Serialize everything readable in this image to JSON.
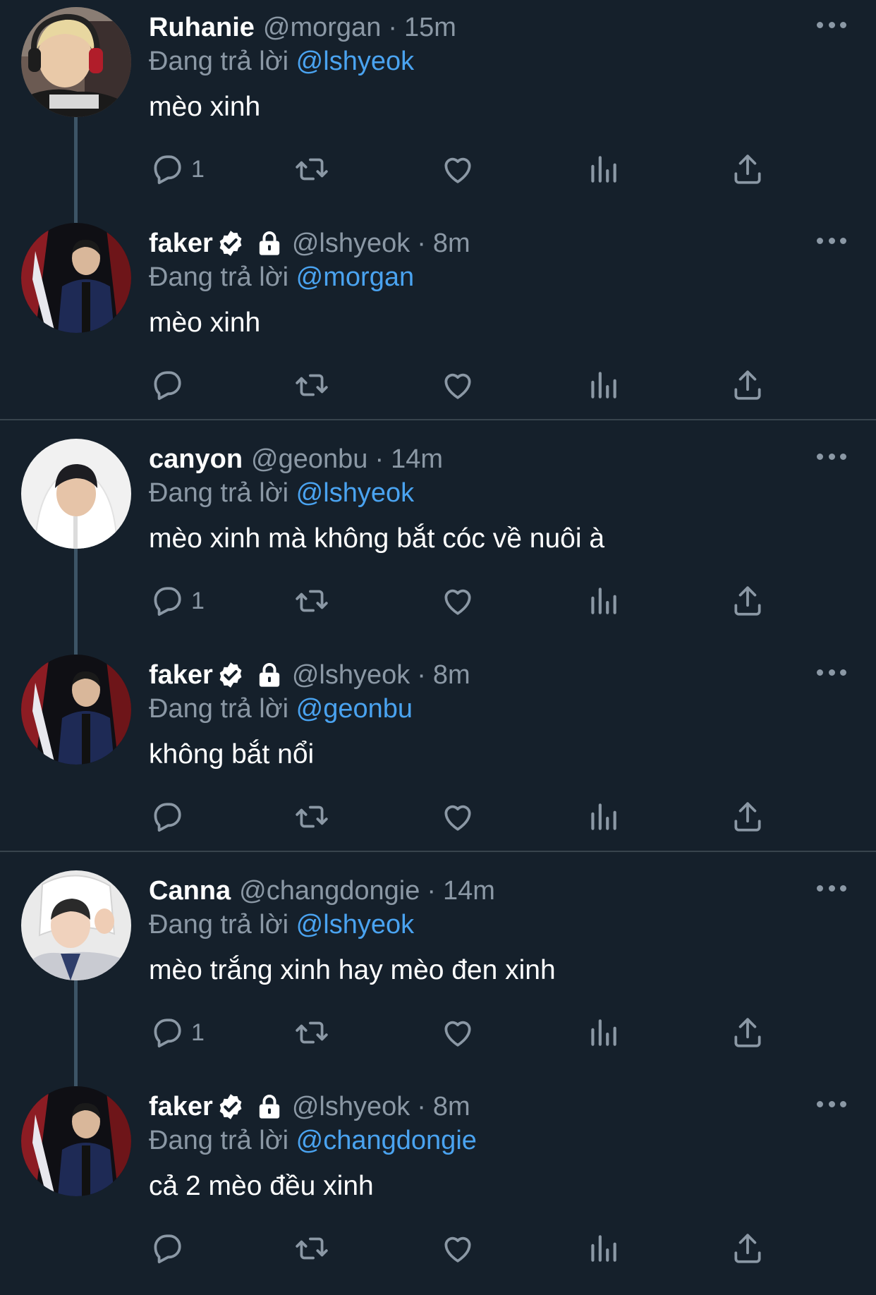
{
  "reply_prefix": "Đang trả lời",
  "separator": "·",
  "tweets": [
    {
      "name": "Ruhanie",
      "handle": "@morgan",
      "time": "15m",
      "reply_to": "@lshyeok",
      "text": "mèo xinh",
      "reply_count": "1",
      "verified": false,
      "protected": false
    },
    {
      "name": "faker",
      "handle": "@lshyeok",
      "time": "8m",
      "reply_to": "@morgan",
      "text": "mèo xinh",
      "reply_count": "",
      "verified": true,
      "protected": true
    },
    {
      "name": "canyon",
      "handle": "@geonbu",
      "time": "14m",
      "reply_to": "@lshyeok",
      "text": "mèo xinh mà không bắt cóc về nuôi à",
      "reply_count": "1",
      "verified": false,
      "protected": false
    },
    {
      "name": "faker",
      "handle": "@lshyeok",
      "time": "8m",
      "reply_to": "@geonbu",
      "text": "không bắt nổi",
      "reply_count": "",
      "verified": true,
      "protected": true
    },
    {
      "name": "Canna",
      "handle": "@changdongie",
      "time": "14m",
      "reply_to": "@lshyeok",
      "text": "mèo trắng xinh hay mèo đen xinh",
      "reply_count": "1",
      "verified": false,
      "protected": false
    },
    {
      "name": "faker",
      "handle": "@lshyeok",
      "time": "8m",
      "reply_to": "@changdongie",
      "text": "cả 2 mèo đều xinh",
      "reply_count": "",
      "verified": true,
      "protected": true
    }
  ],
  "colors": {
    "background": "#15202b",
    "secondary_text": "#8b98a5",
    "mention": "#4aa3f0",
    "divider": "#38444d",
    "thread_line": "#3d5466"
  }
}
